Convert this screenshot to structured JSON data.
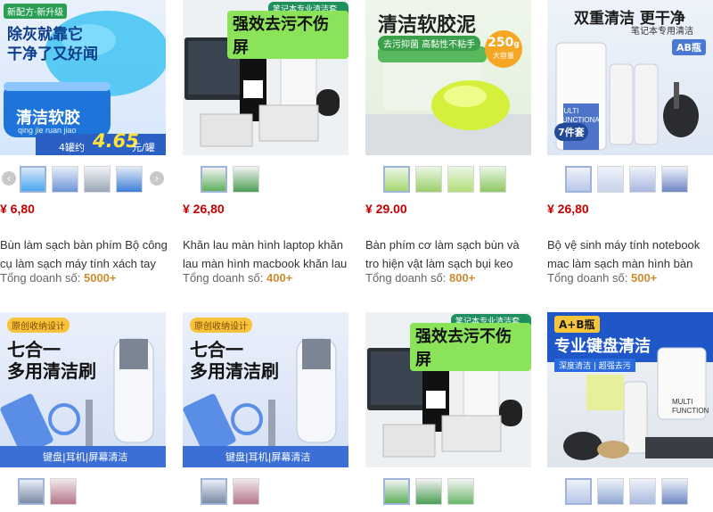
{
  "products": [
    {
      "price": "¥ 6,80",
      "title": "Bùn làm sạch bàn phím Bộ công cụ làm sạch máy tính xách tay",
      "sales_label": "Tổng doanh số:",
      "sales_value": "5000+",
      "hero": {
        "badge": "新配方·新升级",
        "line1": "除灰就靠它",
        "line2": "干净了又好闻",
        "brand": "清洁软胶",
        "pinyin": "qing jie ruan jiao",
        "promo_prefix": "4罐约",
        "promo_price": "4.65",
        "promo_suffix": "元/罐"
      }
    },
    {
      "price": "¥ 26,80",
      "title": "Khăn lau màn hình laptop khăn lau màn hình macbook khăn lau",
      "sales_label": "Tổng doanh số:",
      "sales_value": "400+",
      "hero": {
        "tag": "笔记本专业清洁套装",
        "headline": "强效去污不伤屏"
      }
    },
    {
      "price": "¥ 29.00",
      "title": "Bàn phím cơ làm sạch bùn và tro hiện vật làm sạch bụi keo mềm",
      "sales_label": "Tổng doanh số:",
      "sales_value": "800+",
      "hero": {
        "headline": "清洁软胶泥",
        "sub": "去污抑菌 高黏性不粘手",
        "badge_num": "250",
        "badge_unit": "g",
        "badge_note": "大容量"
      }
    },
    {
      "price": "¥ 26,80",
      "title": "Bộ vệ sinh máy tính notebook mac làm sạch màn hình bàn phím",
      "sales_label": "Tổng doanh số:",
      "sales_value": "500+",
      "hero": {
        "headline": "双重清洁 更干净",
        "sub": "笔记本专用清洁",
        "ab": "AB瓶",
        "count": "7件套",
        "bottle": "MULTI FUNCTIONAL"
      }
    },
    {
      "hero": {
        "tag": "原创收纳设计",
        "headline1": "七合一",
        "headline2": "多用清洁刷",
        "footer": "键盘|耳机|屏幕清洁"
      }
    },
    {
      "hero": {
        "tag": "原创收纳设计",
        "headline1": "七合一",
        "headline2": "多用清洁刷",
        "footer": "键盘|耳机|屏幕清洁"
      }
    },
    {
      "hero": {
        "tag": "笔记本专业清洁套装",
        "headline": "强效去污不伤屏"
      }
    },
    {
      "hero": {
        "ab": "A+B瓶",
        "headline": "专业键盘清洁",
        "sub": "深度清洁 | 超强去污",
        "bottle": "MULTI FUNCTION"
      }
    }
  ],
  "colors": {
    "price": "#c40000",
    "sales_value": "#d08a2e",
    "green": "#2a9e55",
    "blue": "#2f6fd0"
  },
  "icons": {
    "prev": "chevron-left-icon",
    "next": "chevron-right-icon"
  }
}
